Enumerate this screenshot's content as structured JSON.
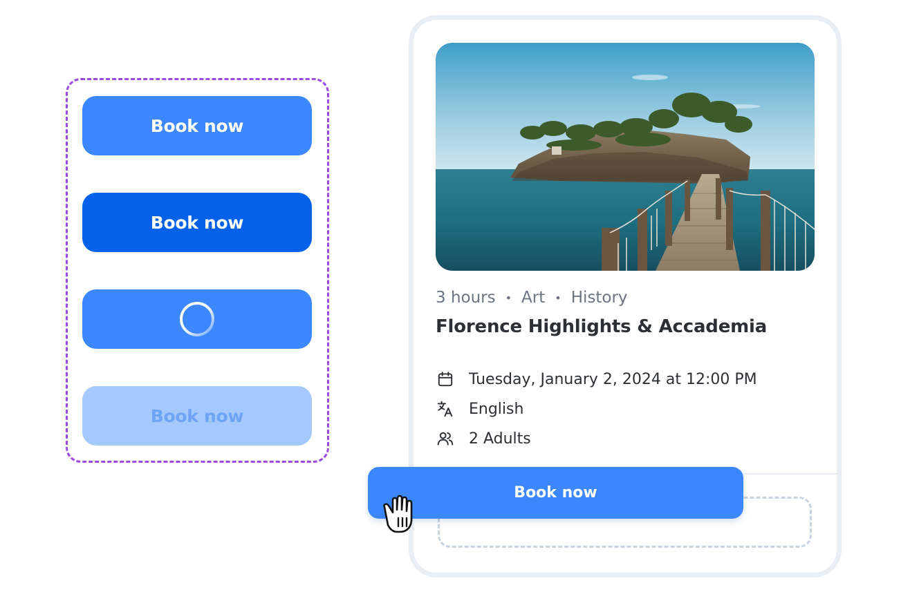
{
  "button_states": [
    {
      "state": "default",
      "label": "Book now"
    },
    {
      "state": "hover",
      "label": "Book now"
    },
    {
      "state": "loading",
      "label": ""
    },
    {
      "state": "disabled",
      "label": "Book now"
    }
  ],
  "card": {
    "meta": {
      "duration": "3 hours",
      "separator": "•",
      "category_1": "Art",
      "category_2": "History"
    },
    "title": "Florence Highlights & Accademia",
    "details": {
      "date": "Tuesday, January 2, 2024 at 12:00 PM",
      "language": "English",
      "travelers": "2 Adults"
    },
    "cta_label": "Book now"
  },
  "icons": {
    "date": "calendar-icon",
    "language": "translate-icon",
    "travelers": "people-icon",
    "loading": "spinner-icon",
    "cursor": "grab-hand-cursor-icon"
  },
  "colors": {
    "primary": "#3b87fb",
    "primary_hover": "#0562e8",
    "primary_disabled": "#a5c9fc",
    "disabled_text": "#6ea4f4",
    "panel_dash": "#9a4be3",
    "card_border": "#e9eef4"
  }
}
